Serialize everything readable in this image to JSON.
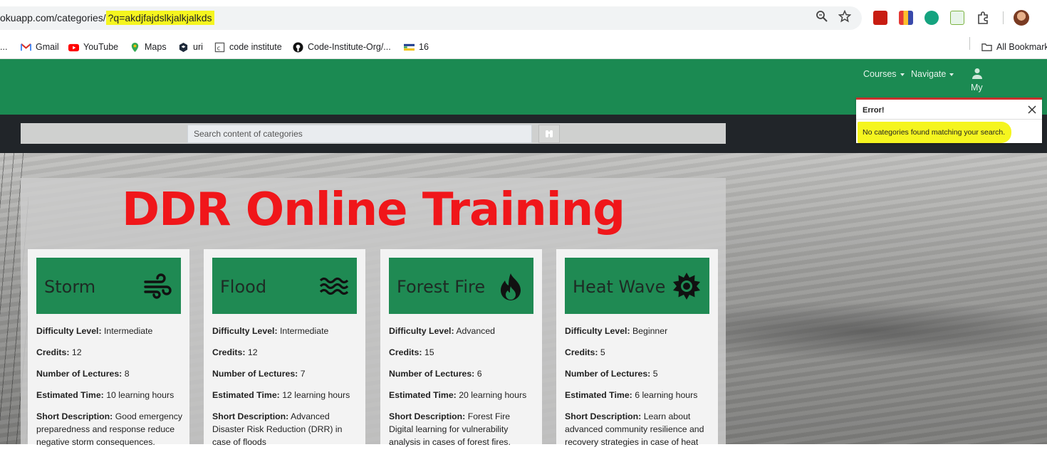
{
  "browser": {
    "url_prefix": "okuapp.com/categories/",
    "url_query": "?q=akdjfajdslkjalkjalkds",
    "bookmarks": [
      {
        "label": "..."
      },
      {
        "label": "Gmail",
        "icon": "gmail-icon"
      },
      {
        "label": "YouTube",
        "icon": "youtube-icon"
      },
      {
        "label": "Maps",
        "icon": "maps-icon"
      },
      {
        "label": "uri",
        "icon": "uri-icon"
      },
      {
        "label": "code institute",
        "icon": "code-institute-icon"
      },
      {
        "label": "Code-Institute-Org/...",
        "icon": "github-icon"
      },
      {
        "label": "16",
        "icon": "flag-icon"
      }
    ],
    "all_bookmarks": "All Bookmarks"
  },
  "nav": {
    "courses": "Courses",
    "navigate": "Navigate",
    "user": "My"
  },
  "search": {
    "placeholder": "Search content of categories"
  },
  "title": "DDR Online Training",
  "labels": {
    "difficulty": "Difficulty Level:",
    "credits": "Credits:",
    "lectures": "Number of Lectures:",
    "time": "Estimated Time:",
    "description": "Short Description:"
  },
  "categories": [
    {
      "name": "Storm",
      "icon": "wind-icon",
      "difficulty": "Intermediate",
      "credits": "12",
      "lectures": "8",
      "time": "10 learning hours",
      "description": "Good emergency preparedness and response reduce negative storm consequences."
    },
    {
      "name": "Flood",
      "icon": "waves-icon",
      "difficulty": "Intermediate",
      "credits": "12",
      "lectures": "7",
      "time": "12 learning hours",
      "description": "Advanced Disaster Risk Reduction (DRR) in case of floods"
    },
    {
      "name": "Forest Fire",
      "icon": "fire-icon",
      "difficulty": "Advanced",
      "credits": "15",
      "lectures": "6",
      "time": "20 learning hours",
      "description": "Forest Fire Digital learning for vulnerability analysis in cases of forest fires."
    },
    {
      "name": "Heat Wave",
      "icon": "sun-icon",
      "difficulty": "Beginner",
      "credits": "5",
      "lectures": "5",
      "time": "6 learning hours",
      "description": "Learn about advanced community resilience and recovery strategies in case of heat"
    }
  ],
  "toast": {
    "title": "Error!",
    "message": "No categories found matching your search."
  },
  "colors": {
    "brand_green": "#1b8a52",
    "title_red": "#f0161a",
    "highlight": "#f5f51f",
    "dark_bar": "#212529"
  }
}
